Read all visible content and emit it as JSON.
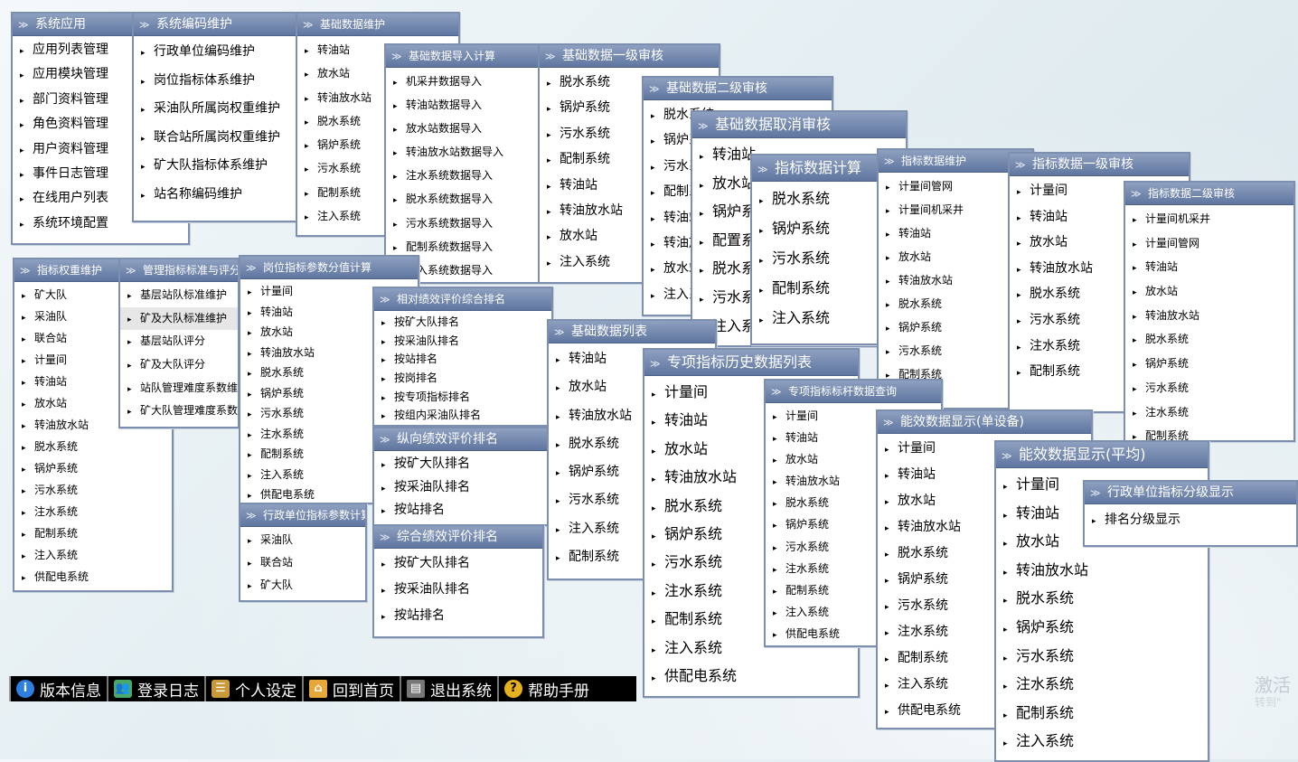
{
  "menus": {
    "app": {
      "title": "系统应用",
      "items": [
        "应用列表管理",
        "应用模块管理",
        "部门资料管理",
        "角色资料管理",
        "用户资料管理",
        "事件日志管理",
        "在线用户列表",
        "系统环境配置"
      ]
    },
    "coding": {
      "title": "系统编码维护",
      "items": [
        "行政单位编码维护",
        "岗位指标体系维护",
        "采油队所属岗权重维护",
        "联合站所属岗权重维护",
        "矿大队指标体系维护",
        "站名称编码维护"
      ]
    },
    "basic_maint": {
      "title": "基础数据维护",
      "items": [
        "转油站",
        "放水站",
        "转油放水站",
        "脱水系统",
        "锅炉系统",
        "污水系统",
        "配制系统",
        "注入系统"
      ]
    },
    "basic_import": {
      "title": "基础数据导入计算",
      "items": [
        "机采井数据导入",
        "转油站数据导入",
        "放水站数据导入",
        "转油放水站数据导入",
        "注水系统数据导入",
        "脱水系统数据导入",
        "污水系统数据导入",
        "配制系统数据导入",
        "注入系统数据导入"
      ]
    },
    "basic_audit1": {
      "title": "基础数据一级审核",
      "items": [
        "脱水系统",
        "锅炉系统",
        "污水系统",
        "配制系统",
        "转油站",
        "转油放水站",
        "放水站",
        "注入系统"
      ]
    },
    "basic_audit2": {
      "title": "基础数据二级审核",
      "items": [
        "脱水系统",
        "锅炉系统",
        "污水系统",
        "配制系统",
        "转油站",
        "转油放水站",
        "放水站",
        "注入系统"
      ]
    },
    "basic_cancel": {
      "title": "基础数据取消审核",
      "items": [
        "转油站",
        "放水站",
        "锅炉系统",
        "配置系统",
        "脱水系统",
        "污水系统",
        "注入系统"
      ]
    },
    "idx_calc": {
      "title": "指标数据计算",
      "items": [
        "脱水系统",
        "锅炉系统",
        "污水系统",
        "配制系统",
        "注入系统"
      ]
    },
    "idx_maint": {
      "title": "指标数据维护",
      "items": [
        "计量间管网",
        "计量间机采井",
        "转油站",
        "放水站",
        "转油放水站",
        "脱水系统",
        "锅炉系统",
        "污水系统",
        "配制系统"
      ]
    },
    "idx_audit1": {
      "title": "指标数据一级审核",
      "items": [
        "计量间",
        "转油站",
        "放水站",
        "转油放水站",
        "脱水系统",
        "污水系统",
        "注水系统",
        "配制系统"
      ]
    },
    "idx_audit2": {
      "title": "指标数据二级审核",
      "items": [
        "计量间机采井",
        "计量间管网",
        "转油站",
        "放水站",
        "转油放水站",
        "脱水系统",
        "锅炉系统",
        "污水系统",
        "注水系统",
        "配制系统"
      ]
    },
    "weight": {
      "title": "指标权重维护",
      "items": [
        "矿大队",
        "采油队",
        "联合站",
        "计量间",
        "转油站",
        "放水站",
        "转油放水站",
        "脱水系统",
        "锅炉系统",
        "污水系统",
        "注水系统",
        "配制系统",
        "注入系统",
        "供配电系统"
      ]
    },
    "mgmt_std": {
      "title": "管理指标标准与评分",
      "items": [
        "基层站队标准维护",
        "矿及大队标准维护",
        "基层站队评分",
        "矿及大队评分",
        "站队管理难度系数维护",
        "矿大队管理难度系数维护"
      ],
      "selected_index": 1
    },
    "post_param": {
      "title": "岗位指标参数分值计算",
      "items": [
        "计量间",
        "转油站",
        "放水站",
        "转油放水站",
        "脱水系统",
        "锅炉系统",
        "污水系统",
        "注水系统",
        "配制系统",
        "注入系统",
        "供配电系统"
      ]
    },
    "admin_param": {
      "title": "行政单位指标参数计算",
      "items": [
        "采油队",
        "联合站",
        "矿大队"
      ]
    },
    "rel_rank": {
      "title": "相对绩效评价综合排名",
      "items": [
        "按矿大队排名",
        "按采油队排名",
        "按站排名",
        "按岗排名",
        "按专项指标排名",
        "按组内采油队排名"
      ]
    },
    "vert_rank": {
      "title": "纵向绩效评价排名",
      "items": [
        "按矿大队排名",
        "按采油队排名",
        "按站排名"
      ]
    },
    "comp_rank": {
      "title": "综合绩效评价排名",
      "items": [
        "按矿大队排名",
        "按采油队排名",
        "按站排名"
      ]
    },
    "basic_list": {
      "title": "基础数据列表",
      "items": [
        "转油站",
        "放水站",
        "转油放水站",
        "脱水系统",
        "锅炉系统",
        "污水系统",
        "注入系统",
        "配制系统"
      ]
    },
    "special_hist": {
      "title": "专项指标历史数据列表",
      "items": [
        "计量间",
        "转油站",
        "放水站",
        "转油放水站",
        "脱水系统",
        "锅炉系统",
        "污水系统",
        "注水系统",
        "配制系统",
        "注入系统",
        "供配电系统"
      ]
    },
    "special_bench": {
      "title": "专项指标标杆数据查询",
      "items": [
        "计量间",
        "转油站",
        "放水站",
        "转油放水站",
        "脱水系统",
        "锅炉系统",
        "污水系统",
        "注水系统",
        "配制系统",
        "注入系统",
        "供配电系统"
      ]
    },
    "energy_single": {
      "title": "能效数据显示(单设备)",
      "items": [
        "计量间",
        "转油站",
        "放水站",
        "转油放水站",
        "脱水系统",
        "锅炉系统",
        "污水系统",
        "注水系统",
        "配制系统",
        "注入系统",
        "供配电系统"
      ]
    },
    "energy_avg": {
      "title": "能效数据显示(平均)",
      "items": [
        "计量间",
        "转油站",
        "放水站",
        "转油放水站",
        "脱水系统",
        "锅炉系统",
        "污水系统",
        "注水系统",
        "配制系统",
        "注入系统"
      ]
    },
    "admin_grade": {
      "title": "行政单位指标分级显示",
      "items": [
        "排名分级显示"
      ]
    }
  },
  "toolbar": [
    {
      "label": "版本信息",
      "icon": "info-icon"
    },
    {
      "label": "登录日志",
      "icon": "users-icon"
    },
    {
      "label": "个人设定",
      "icon": "settings-icon"
    },
    {
      "label": "回到首页",
      "icon": "home-icon"
    },
    {
      "label": "退出系统",
      "icon": "exit-icon"
    },
    {
      "label": "帮助手册",
      "icon": "help-icon"
    }
  ],
  "watermark": {
    "line1": "激活",
    "line2": "转到\""
  },
  "colors": {
    "header_top": "#8ea0c0",
    "header_bottom": "#5f76a0",
    "border": "#7c8fae",
    "toolbar_bg": "#000000"
  }
}
